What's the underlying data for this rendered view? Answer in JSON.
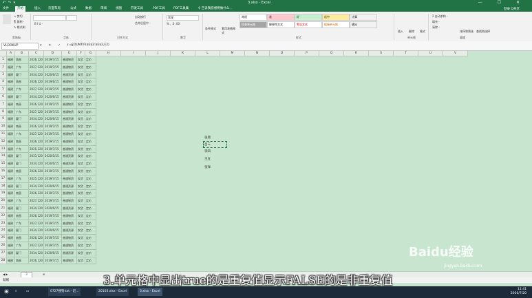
{
  "window": {
    "title": "3.xlsx - Excel",
    "quick_access": "↶ ↷ ▾",
    "controls": "— ☐ ✕"
  },
  "ribbon_tabs": [
    "文件",
    "开始",
    "插入",
    "页面布局",
    "公式",
    "数据",
    "审阅",
    "视图",
    "开发工具",
    "PDF工具",
    "PDF工具集",
    "♀ 告诉我您想要做什么..."
  ],
  "login": "登录 Q共享",
  "ribbon": {
    "clipboard": {
      "cut": "✂ 剪切",
      "copy": "⎘ 复制 -",
      "painter": "✎ 格式刷",
      "group": "剪贴板"
    },
    "font": {
      "group": "字体",
      "bold": "B I U -"
    },
    "alignment": {
      "group": "对齐方式",
      "wrap": "自动换行",
      "merge": "合并后居中 -"
    },
    "number": {
      "group": "数字",
      "format": "常规",
      "symbols": "% , .0 .00"
    },
    "styles": {
      "group": "样式",
      "boxes": [
        "常规",
        "差",
        "好",
        "适中",
        "计算",
        "检查单元格",
        "解释性文本",
        "警告文本",
        "链接单元格",
        "输出"
      ]
    },
    "cells": {
      "group": "单元格",
      "insert": "插入",
      "delete": "删除",
      "format": "格式"
    },
    "editing": {
      "group": "编辑",
      "autosum": "Σ 自动求和 -",
      "fill": "填充 -",
      "clear": "清除 -",
      "sort": "排序和筛选",
      "find": "查找和选择"
    },
    "conditional": "条件格式",
    "table_format": "套用表格格式"
  },
  "formula_bar": {
    "name_box": "VLOOKUP",
    "icons": "▾ ✕ ✓ fx",
    "formula": "=COUNTIF($E$2:$E$3,E2)"
  },
  "columns": [
    "A",
    "B",
    "C",
    "D",
    "E",
    "F",
    "G",
    "H",
    "I",
    "J",
    "K",
    "L",
    "M",
    "N",
    "O",
    "P",
    "Q",
    "R",
    "S",
    "T",
    "U",
    "V"
  ],
  "rows": [
    [
      "福建",
      "南昌",
      "2026,120",
      "2019/7/15",
      "普通物资",
      "发货",
      "定价"
    ],
    [
      "福建",
      "广东",
      "2027,120",
      "2019/7/15",
      "普通物资",
      "发货",
      "定价"
    ],
    [
      "福建",
      "厦门",
      "2034,120",
      "2020/6/15",
      "普通资源",
      "发货",
      "定价"
    ],
    [
      "福建",
      "南昌",
      "2026,120",
      "2019/6/15",
      "普通物资",
      "发货",
      "定价"
    ],
    [
      "福建",
      "广东",
      "2027,120",
      "2019/7/15",
      "普通物资",
      "发货",
      "定价"
    ],
    [
      "福建",
      "厦门",
      "2034,120",
      "2020/6/15",
      "普通资源",
      "发货",
      "定价"
    ],
    [
      "福建",
      "南昌",
      "2026,120",
      "2019/7/15",
      "普通物资",
      "发货",
      "定价"
    ],
    [
      "福建",
      "广东",
      "2027,120",
      "2019/7/15",
      "普通物资",
      "发货",
      "定价"
    ],
    [
      "福建",
      "厦门",
      "2034,120",
      "2020/6/15",
      "普通资源",
      "发货",
      "定价"
    ],
    [
      "福建",
      "南昌",
      "2026,120",
      "2019/7/15",
      "普通物资",
      "发货",
      "定价"
    ],
    [
      "福建",
      "广东",
      "2027,120",
      "2019/7/15",
      "普通物资",
      "发货",
      "定价"
    ],
    [
      "福建",
      "南昌",
      "2026,120",
      "2019/7/15",
      "普通物资",
      "发货",
      "定价"
    ],
    [
      "福建",
      "广东",
      "2025,120",
      "2019/7/15",
      "普通物资",
      "发货",
      "定价"
    ],
    [
      "福建",
      "厦门",
      "2033,120",
      "2020/5/15",
      "普通资源",
      "发货",
      "定价"
    ],
    [
      "福建",
      "厦门",
      "2034,120",
      "2020/6/15",
      "普通资源",
      "发货",
      "定价"
    ],
    [
      "福建",
      "南昌",
      "2026,120",
      "2019/7/15",
      "普通物资",
      "发货",
      "定价"
    ],
    [
      "福建",
      "广东",
      "2025,120",
      "2019/7/15",
      "普通物资",
      "发货",
      "定价"
    ],
    [
      "福建",
      "厦门",
      "2034,120",
      "2020/6/15",
      "普通资源",
      "发货",
      "定价"
    ],
    [
      "福建",
      "南昌",
      "2026,120",
      "2019/7/15",
      "普通物资",
      "发货",
      "定价"
    ],
    [
      "福建",
      "广东",
      "2027,120",
      "2019/7/15",
      "普通物资",
      "发货",
      "定价"
    ],
    [
      "福建",
      "厦门",
      "2034,120",
      "2020/6/15",
      "普通资源",
      "发货",
      "定价"
    ],
    [
      "福建",
      "南昌",
      "2026,120",
      "2019/7/15",
      "普通物资",
      "发货",
      "定价"
    ],
    [
      "福建",
      "广东",
      "2027,120",
      "2019/7/15",
      "普通物资",
      "发货",
      "定价"
    ],
    [
      "福建",
      "厦门",
      "2034,120",
      "2020/6/15",
      "普通资源",
      "发货",
      "定价"
    ],
    [
      "福建",
      "南昌",
      "2026,120",
      "2019/7/15",
      "普通物资",
      "发货",
      "定价"
    ],
    [
      "福建",
      "广东",
      "2027,120",
      "2019/7/15",
      "普通物资",
      "发货",
      "定价"
    ],
    [
      "福建",
      "厦门",
      "2034,120",
      "2020/6/15",
      "普通资源",
      "发货",
      "定价"
    ],
    [
      "福建",
      "南昌",
      "2026,120",
      "2019/7/15",
      "普通物资",
      "发货",
      "定价"
    ],
    [
      "福建",
      "广东",
      "2027,120",
      "2019/7/15",
      "普通物资",
      "发货",
      "定价"
    ]
  ],
  "float_values": [
    "张增",
    "吕三",
    "李四",
    "王五",
    "张祥"
  ],
  "sheet_tab": "3",
  "status": "就绪",
  "taskbar": {
    "start": "⊞",
    "items": [
      "0727搜狗.txt - 记...",
      "20103.xlsx - Excel",
      "3.xlsx - Excel"
    ],
    "clock_time": "11:41",
    "clock_date": "2020/7/20"
  },
  "caption": "3.单元格中显出true的是重复值显示FALSE的是非重复值",
  "watermark": "Baidu经验",
  "watermark_url": "jingyan.baidu.com"
}
